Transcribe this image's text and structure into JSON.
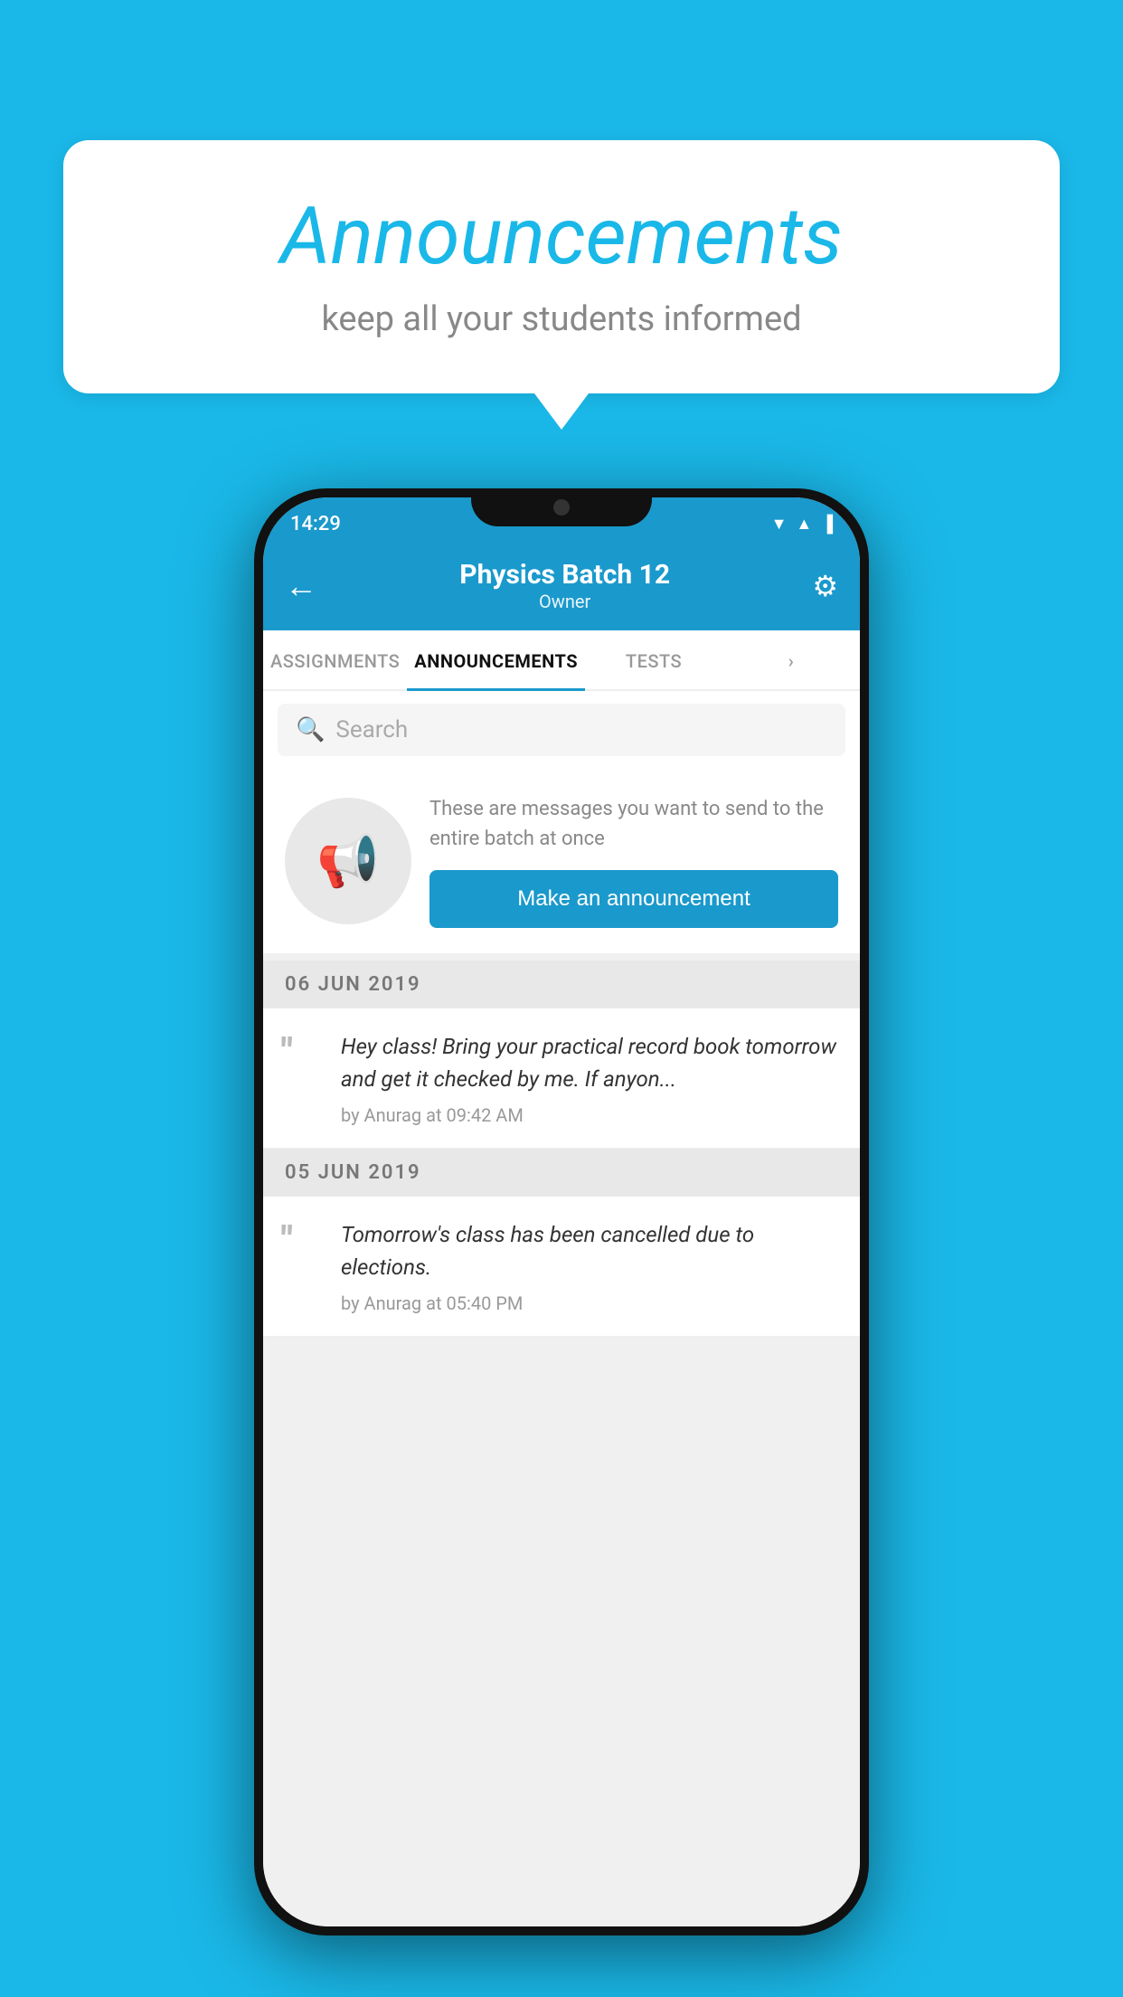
{
  "background_color": "#1ab8e8",
  "speech_bubble": {
    "title": "Announcements",
    "subtitle": "keep all your students informed"
  },
  "phone": {
    "status_bar": {
      "time": "14:29",
      "icons": [
        "▼",
        "▲",
        "▐"
      ]
    },
    "header": {
      "title": "Physics Batch 12",
      "subtitle": "Owner",
      "back_label": "←",
      "settings_label": "⚙"
    },
    "tabs": [
      {
        "label": "ASSIGNMENTS",
        "active": false
      },
      {
        "label": "ANNOUNCEMENTS",
        "active": true
      },
      {
        "label": "TESTS",
        "active": false
      },
      {
        "label": "›",
        "active": false
      }
    ],
    "search": {
      "placeholder": "Search"
    },
    "promo": {
      "description": "These are messages you want to send to the entire batch at once",
      "button_label": "Make an announcement"
    },
    "announcements": [
      {
        "date": "06  JUN  2019",
        "text": "Hey class! Bring your practical record book tomorrow and get it checked by me. If anyon...",
        "meta": "by Anurag at 09:42 AM"
      },
      {
        "date": "05  JUN  2019",
        "text": "Tomorrow's class has been cancelled due to elections.",
        "meta": "by Anurag at 05:40 PM"
      }
    ]
  }
}
